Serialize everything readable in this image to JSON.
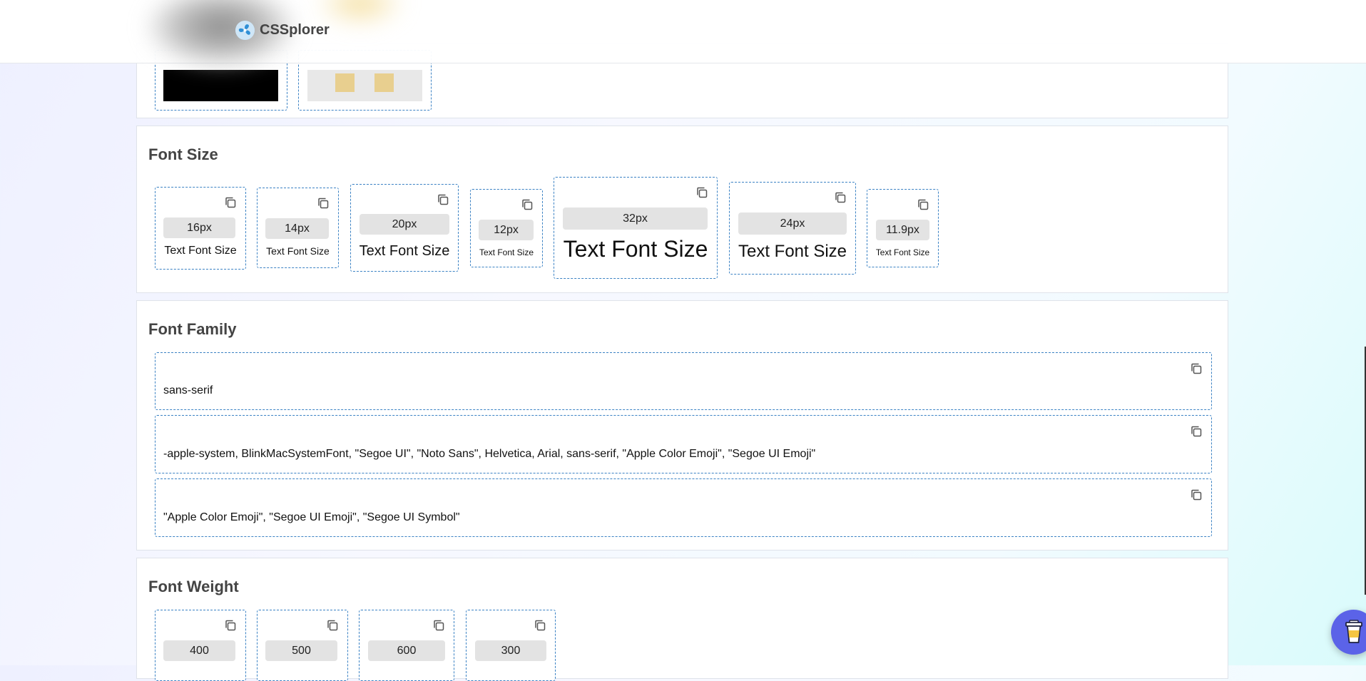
{
  "header": {
    "app_name": "CSSplorer",
    "logo_icon": "fan-logo-icon"
  },
  "sections": {
    "font_size": {
      "title": "Font Size",
      "sample_text": "Text Font Size",
      "cards": [
        {
          "value": "16px"
        },
        {
          "value": "14px"
        },
        {
          "value": "20px"
        },
        {
          "value": "12px"
        },
        {
          "value": "32px"
        },
        {
          "value": "24px"
        },
        {
          "value": "11.9px"
        }
      ]
    },
    "font_family": {
      "title": "Font Family",
      "cards": [
        {
          "value": "sans-serif"
        },
        {
          "value": "-apple-system, BlinkMacSystemFont, \"Segoe UI\", \"Noto Sans\", Helvetica, Arial, sans-serif, \"Apple Color Emoji\", \"Segoe UI Emoji\""
        },
        {
          "value": "\"Apple Color Emoji\", \"Segoe UI Emoji\", \"Segoe UI Symbol\""
        }
      ]
    },
    "font_weight": {
      "title": "Font Weight",
      "cards": [
        {
          "value": "400"
        },
        {
          "value": "500"
        },
        {
          "value": "600"
        },
        {
          "value": "300"
        }
      ]
    }
  },
  "colors": {
    "accent_border": "#3b82c4",
    "fab": "#5b63e8",
    "swatch_black": "#000000",
    "swatch_tan": "#e8cf8f"
  },
  "icons": {
    "copy": "copy-icon",
    "fab": "coffee-cup-icon"
  }
}
